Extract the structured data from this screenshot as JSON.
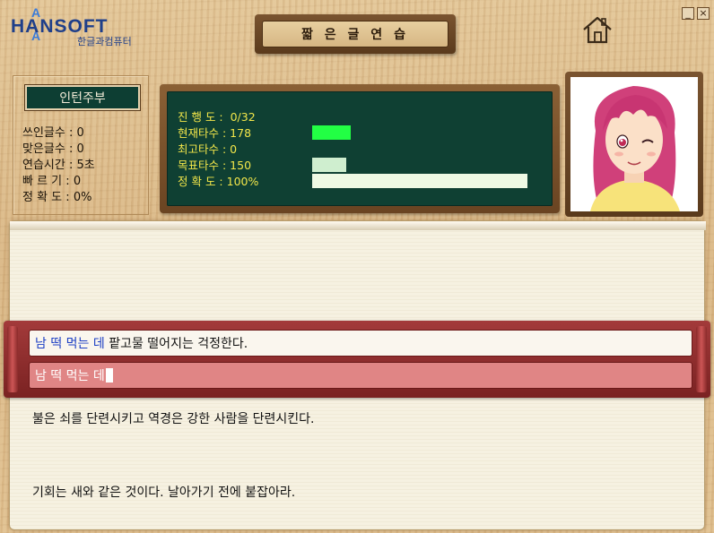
{
  "logo": {
    "brand": "HANSOFT",
    "subtitle": "한글과컴퓨터"
  },
  "window_buttons": {
    "minimize": "_",
    "close": "×"
  },
  "title": "짧 은 글  연 습",
  "user": {
    "rank": "인턴주부"
  },
  "stats": [
    {
      "label": "쓰인글수",
      "value": "0"
    },
    {
      "label": "맞은글수",
      "value": "0"
    },
    {
      "label": "연습시간",
      "value": "5초"
    },
    {
      "label": "빠 르 기",
      "value": "0"
    },
    {
      "label": "정 확 도",
      "value": "0%"
    }
  ],
  "board": {
    "progress": {
      "label": "진 행 도 :",
      "value": "0/32"
    },
    "current_speed": {
      "label": "현재타수 :",
      "value": "178",
      "bar_fraction": 0.18,
      "bar_color": "#22ff44"
    },
    "max_speed": {
      "label": "최고타수 :",
      "value": "0"
    },
    "target_speed": {
      "label": "목표타수 :",
      "value": "150",
      "bar_fraction": 0.16,
      "bar_color": "#cfeecf"
    },
    "accuracy": {
      "label": "정 확 도 :",
      "value": "100%",
      "bar_fraction": 1.0,
      "bar_color": "#eef9e4"
    }
  },
  "typing": {
    "target_typed": "남 떡 먹는 데",
    "target_rest": " 팥고물 떨어지는 걱정한다.",
    "input_value": "남 떡 먹는 데"
  },
  "next_sentences": [
    "불은 쇠를 단련시키고 역경은 강한 사람을 단련시킨다.",
    "기회는 새와 같은 것이다. 날아가기 전에 붙잡아라."
  ],
  "colors": {
    "board_bg": "#0f4033",
    "board_text": "#f2e64a",
    "typed_highlight": "#1c3fc4",
    "band": "#a33a3a"
  }
}
